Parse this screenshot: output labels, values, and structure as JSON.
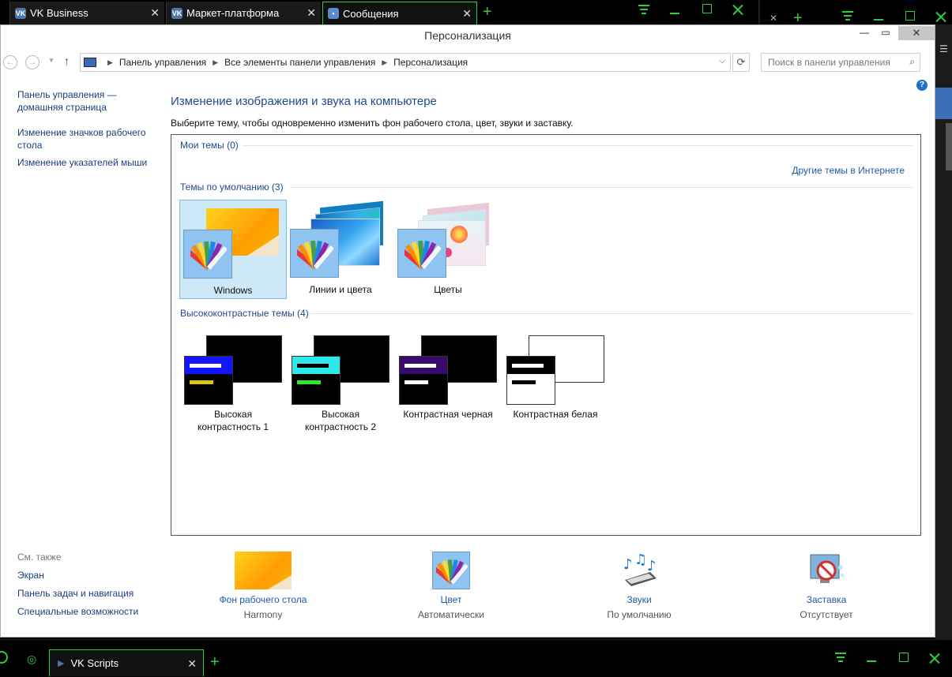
{
  "browser": {
    "tabs": [
      {
        "label": "VK Business",
        "active": false
      },
      {
        "label": "Маркет-платформа",
        "active": false
      },
      {
        "label": "Сообщения",
        "active": true
      }
    ]
  },
  "window": {
    "title": "Персонализация",
    "breadcrumb": [
      "Панель управления",
      "Все элементы панели управления",
      "Персонализация"
    ],
    "search_placeholder": "Поиск в панели управления"
  },
  "sidebar": {
    "home_line1": "Панель управления —",
    "home_line2": "домашняя страница",
    "icons_line1": "Изменение значков рабочего",
    "icons_line2": "стола",
    "pointers": "Изменение указателей мыши",
    "see_also": "См. также",
    "see_also_items": [
      "Экран",
      "Панель задач и навигация",
      "Специальные возможности"
    ]
  },
  "main": {
    "heading": "Изменение изображения и звука на компьютере",
    "subtitle": "Выберите тему, чтобы одновременно изменить фон рабочего стола, цвет, звуки и заставку.",
    "my_themes": "Мои темы (0)",
    "other_themes_link": "Другие темы в Интернете",
    "default_themes": "Темы по умолчанию (3)",
    "default_list": [
      "Windows",
      "Линии и цвета",
      "Цветы"
    ],
    "high_contrast": "Высококонтрастные темы (4)",
    "hc_list": [
      {
        "line1": "Высокая",
        "line2": "контрастность 1"
      },
      {
        "line1": "Высокая",
        "line2": "контрастность 2"
      },
      {
        "line1": "Контрастная черная",
        "line2": ""
      },
      {
        "line1": "Контрастная белая",
        "line2": ""
      }
    ]
  },
  "bottom": [
    {
      "label": "Фон рабочего стола",
      "value": "Harmony"
    },
    {
      "label": "Цвет",
      "value": "Автоматически"
    },
    {
      "label": "Звуки",
      "value": "По умолчанию"
    },
    {
      "label": "Заставка",
      "value": "Отсутствует"
    }
  ],
  "taskbar": {
    "tab_label": "VK Scripts"
  },
  "colors": {
    "accent_green": "#2ecc40",
    "link_blue": "#1e5aa8",
    "selected_bg": "#cde8f7"
  }
}
